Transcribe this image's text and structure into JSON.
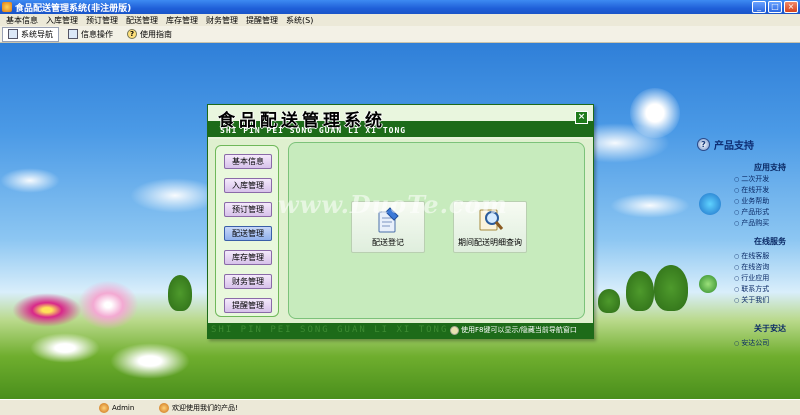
{
  "window": {
    "title": "食品配送管理系统(非注册版)",
    "controls": [
      "_",
      "□",
      "×"
    ]
  },
  "menu": [
    "基本信息",
    "入库管理",
    "预订管理",
    "配送管理",
    "库存管理",
    "财务管理",
    "提醒管理",
    "系统(S)"
  ],
  "toolbar": [
    {
      "label": "系统导航",
      "icon": "monitor-icon",
      "active": true
    },
    {
      "label": "信息操作",
      "icon": "document-icon",
      "active": false
    },
    {
      "label": "使用指南",
      "icon": "help-icon",
      "active": false
    }
  ],
  "dialog": {
    "title_cn": "食品配送管理系统",
    "title_pinyin": "SHI PIN PEI SONG GUAN LI XI TONG",
    "close": "×",
    "nav": [
      "基本信息",
      "入库管理",
      "预订管理",
      "配送管理",
      "库存管理",
      "财务管理",
      "提醒管理"
    ],
    "active_nav": "配送管理",
    "functions": [
      {
        "label": "配送登记",
        "icon": "delivery-register-icon"
      },
      {
        "label": "期间配送明细查询",
        "icon": "search-magnifier-icon"
      }
    ],
    "footer_marquee": "SHI PIN PEI SONG GUAN LI XI TONG",
    "footer_hint": "使用F8键可以显示/隐藏当前导航窗口"
  },
  "support": {
    "title": "产品支持",
    "sections": [
      {
        "heading": "应用支持",
        "items": [
          "二次开发",
          "在线开发",
          "业务帮助",
          "产品形式",
          "产品购买"
        ]
      },
      {
        "heading": "在线服务",
        "items": [
          "在线客服",
          "在线咨询",
          "行业应用",
          "联系方式",
          "关于我们"
        ]
      },
      {
        "heading": "关于安达",
        "items": [
          "安达公司"
        ]
      }
    ]
  },
  "watermark": "www.DuoTe.com",
  "status": {
    "user": "Admin",
    "message": "欢迎使用我们的产品!"
  },
  "colors": {
    "titlebar": "#1f5fd8",
    "dialog_band": "#1d6b19",
    "dialog_bg": "#e7f4d9",
    "content_bg": "#c7ebbd"
  }
}
